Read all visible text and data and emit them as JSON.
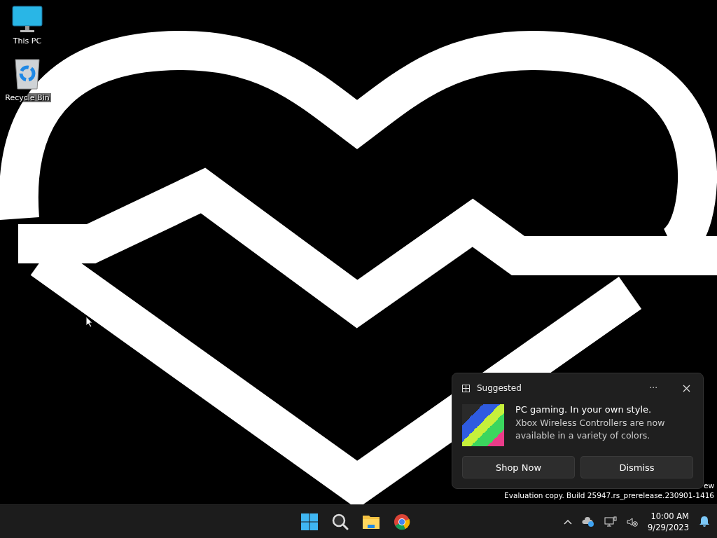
{
  "desktop_icons": [
    {
      "label": "This PC",
      "kind": "computer"
    },
    {
      "label": "Recycle Bin",
      "kind": "recycle"
    }
  ],
  "notification": {
    "app": "Suggested",
    "title": "PC gaming. In your own style.",
    "body": "Xbox Wireless Controllers are now available in a variety of colors.",
    "more": "···",
    "buttons": [
      "Shop Now",
      "Dismiss"
    ]
  },
  "watermark": [
    "ew",
    "Evaluation copy. Build 25947.rs_prerelease.230901-1416"
  ],
  "taskbar": {
    "apps": [
      {
        "kind": "start"
      },
      {
        "kind": "search"
      },
      {
        "kind": "folder"
      },
      {
        "kind": "browser"
      }
    ],
    "tray": [
      {
        "kind": "chevron"
      },
      {
        "kind": "cloud"
      },
      {
        "kind": "network"
      },
      {
        "kind": "volume"
      }
    ],
    "time": "10:00 AM",
    "date": "9/29/2023"
  }
}
